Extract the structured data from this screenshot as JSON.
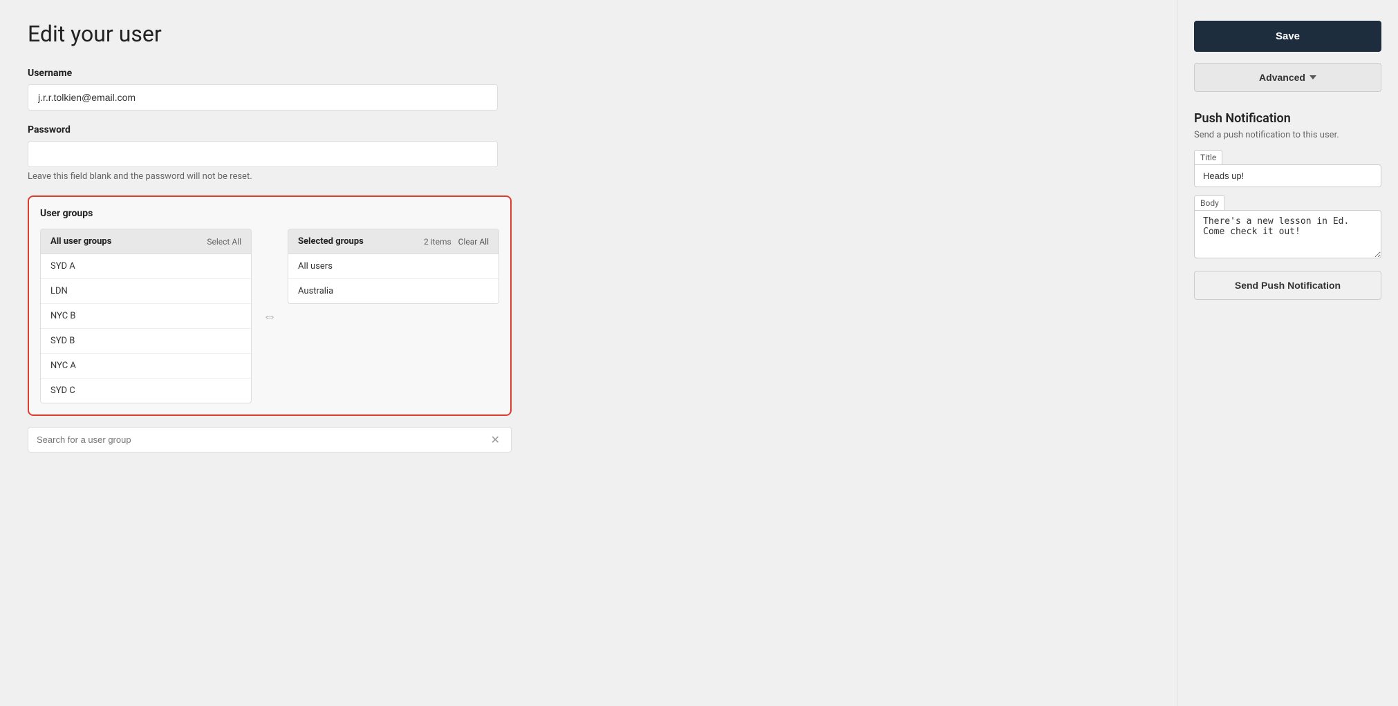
{
  "page": {
    "title": "Edit your user"
  },
  "form": {
    "username_label": "Username",
    "username_value": "j.r.r.tolkien@email.com",
    "password_label": "Password",
    "password_value": "",
    "password_hint": "Leave this field blank and the password will not be reset.",
    "user_groups_title": "User groups",
    "all_groups_label": "All user groups",
    "select_all_label": "Select All",
    "selected_groups_label": "Selected groups",
    "selected_count": "2 items",
    "clear_all_label": "Clear All",
    "all_groups_items": [
      "SYD A",
      "LDN",
      "NYC B",
      "SYD B",
      "NYC A",
      "SYD C"
    ],
    "selected_groups_items": [
      "All users",
      "Australia"
    ],
    "search_placeholder": "Search for a user group"
  },
  "sidebar": {
    "save_label": "Save",
    "advanced_label": "Advanced",
    "push_notification": {
      "title": "Push Notification",
      "description": "Send a push notification to this user.",
      "title_field_label": "Title",
      "title_value": "Heads up!",
      "body_field_label": "Body",
      "body_value": "There's a new lesson in Ed. Come check it out!",
      "send_button_label": "Send Push Notification"
    }
  },
  "icons": {
    "transfer": "⇔",
    "chevron_down": "▾",
    "close": "✕"
  }
}
